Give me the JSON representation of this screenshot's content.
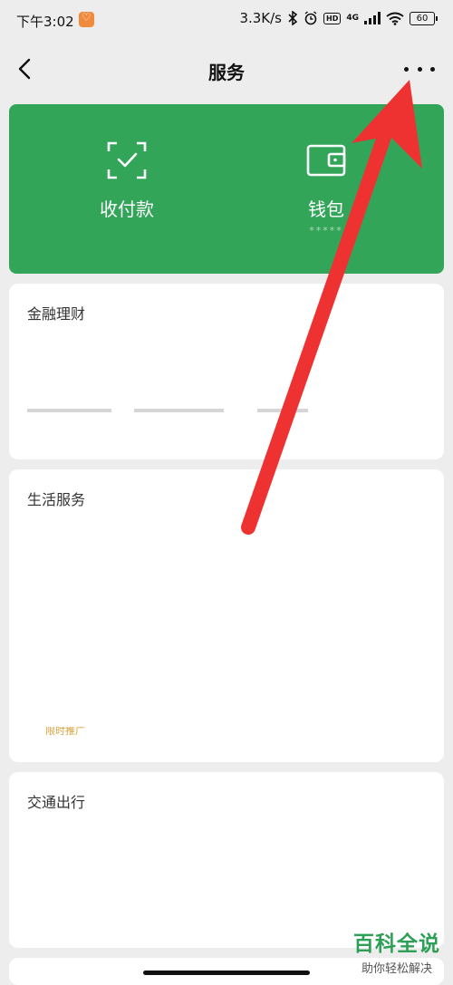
{
  "status_bar": {
    "time": "下午3:02",
    "network_speed": "3.3K/s",
    "hd_badge": "HD",
    "network_type": "4G",
    "battery": "60"
  },
  "nav": {
    "title": "服务"
  },
  "wallet_card": {
    "pay_label": "收付款",
    "wallet_label": "钱包",
    "wallet_balance_mask": "*****",
    "bg_color": "#33a559"
  },
  "sections": [
    {
      "title": "金融理财"
    },
    {
      "title": "生活服务",
      "promo_fragment": "限时推广"
    },
    {
      "title": "交通出行"
    }
  ],
  "watermark": {
    "main": "百科全说",
    "sub": "助你轻松解决"
  },
  "colors": {
    "accent_green": "#33a559",
    "annotation_red": "#ee3232"
  }
}
